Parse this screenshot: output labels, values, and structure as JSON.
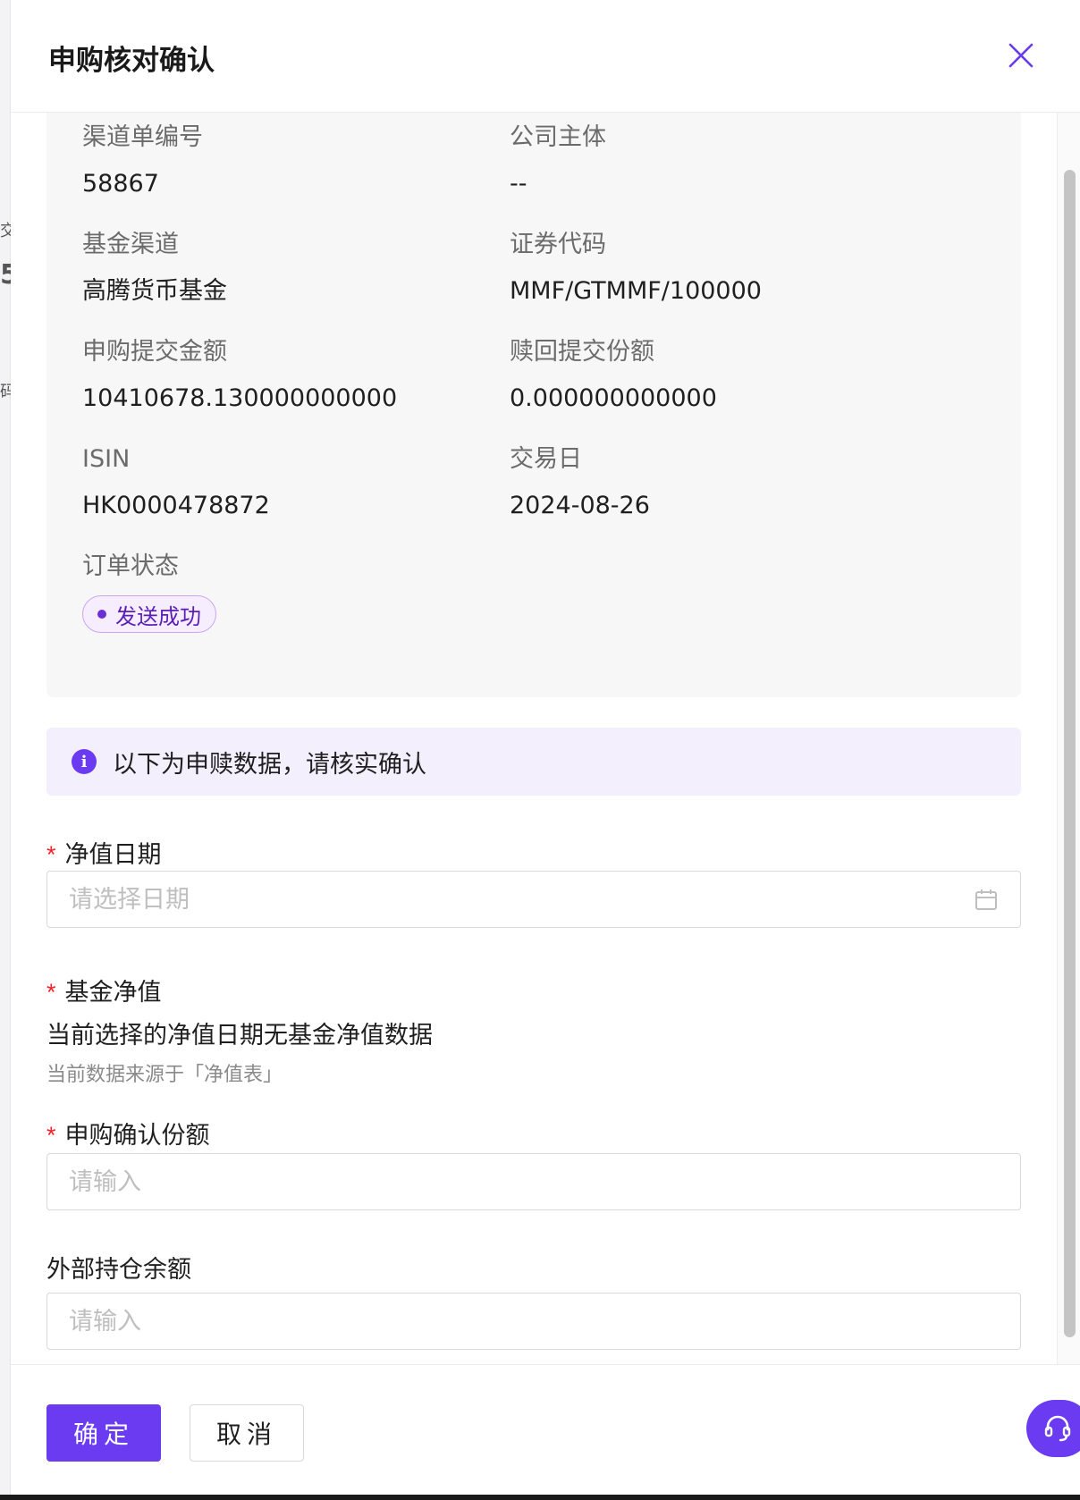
{
  "drawer": {
    "title": "申购核对确认"
  },
  "backdrop_fragments": [
    "交",
    "5",
    "码"
  ],
  "info": {
    "channel_order_no": {
      "label": "渠道单编号",
      "value": "58867"
    },
    "company_entity": {
      "label": "公司主体",
      "value": "--"
    },
    "fund_channel": {
      "label": "基金渠道",
      "value": "高腾货币基金"
    },
    "security_code": {
      "label": "证券代码",
      "value": "MMF/GTMMF/100000"
    },
    "subscription_amount": {
      "label": "申购提交金额",
      "value": "10410678.130000000000"
    },
    "redemption_shares": {
      "label": "赎回提交份额",
      "value": "0.000000000000"
    },
    "isin": {
      "label": "ISIN",
      "value": "HK0000478872"
    },
    "trade_date": {
      "label": "交易日",
      "value": "2024-08-26"
    },
    "order_status": {
      "label": "订单状态",
      "value": "发送成功"
    }
  },
  "alert": {
    "icon": "info-icon",
    "text": "以下为申赎数据，请核实确认"
  },
  "form": {
    "nav_date": {
      "label": "净值日期",
      "placeholder": "请选择日期",
      "value": ""
    },
    "nav": {
      "label": "基金净值",
      "message": "当前选择的净值日期无基金净值数据",
      "source": "当前数据来源于「净值表」"
    },
    "confirmed_shares": {
      "label": "申购确认份额",
      "placeholder": "请输入",
      "value": ""
    },
    "external_balance": {
      "label": "外部持仓余额",
      "placeholder": "请输入",
      "value": ""
    }
  },
  "footer": {
    "confirm_label": "确定",
    "cancel_label": "取消"
  },
  "colors": {
    "primary": "#6a3bf0",
    "required": "#f5222d",
    "status_badge": "#5b1fb5"
  }
}
